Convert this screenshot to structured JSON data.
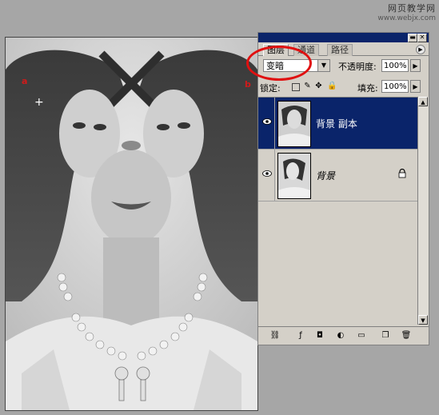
{
  "watermark": {
    "line1": "网页教学网",
    "line2": "www.webjx.com"
  },
  "canvas": {
    "markers": {
      "left": "a",
      "right": "b"
    }
  },
  "layers_panel": {
    "tabs": [
      "图层",
      "通道",
      "路径"
    ],
    "blend_mode": "变暗",
    "opacity_label": "不透明度:",
    "opacity_value": "100%",
    "lock_label": "锁定:",
    "fill_label": "填充:",
    "fill_value": "100%",
    "layers": [
      {
        "name": "背景 副本",
        "selected": true,
        "visible": true
      },
      {
        "name": "背景",
        "selected": false,
        "visible": true,
        "locked": true
      }
    ]
  },
  "colors": {
    "selection": "#0a246a",
    "panel_bg": "#d4d0c8",
    "highlight": "#e01010"
  }
}
